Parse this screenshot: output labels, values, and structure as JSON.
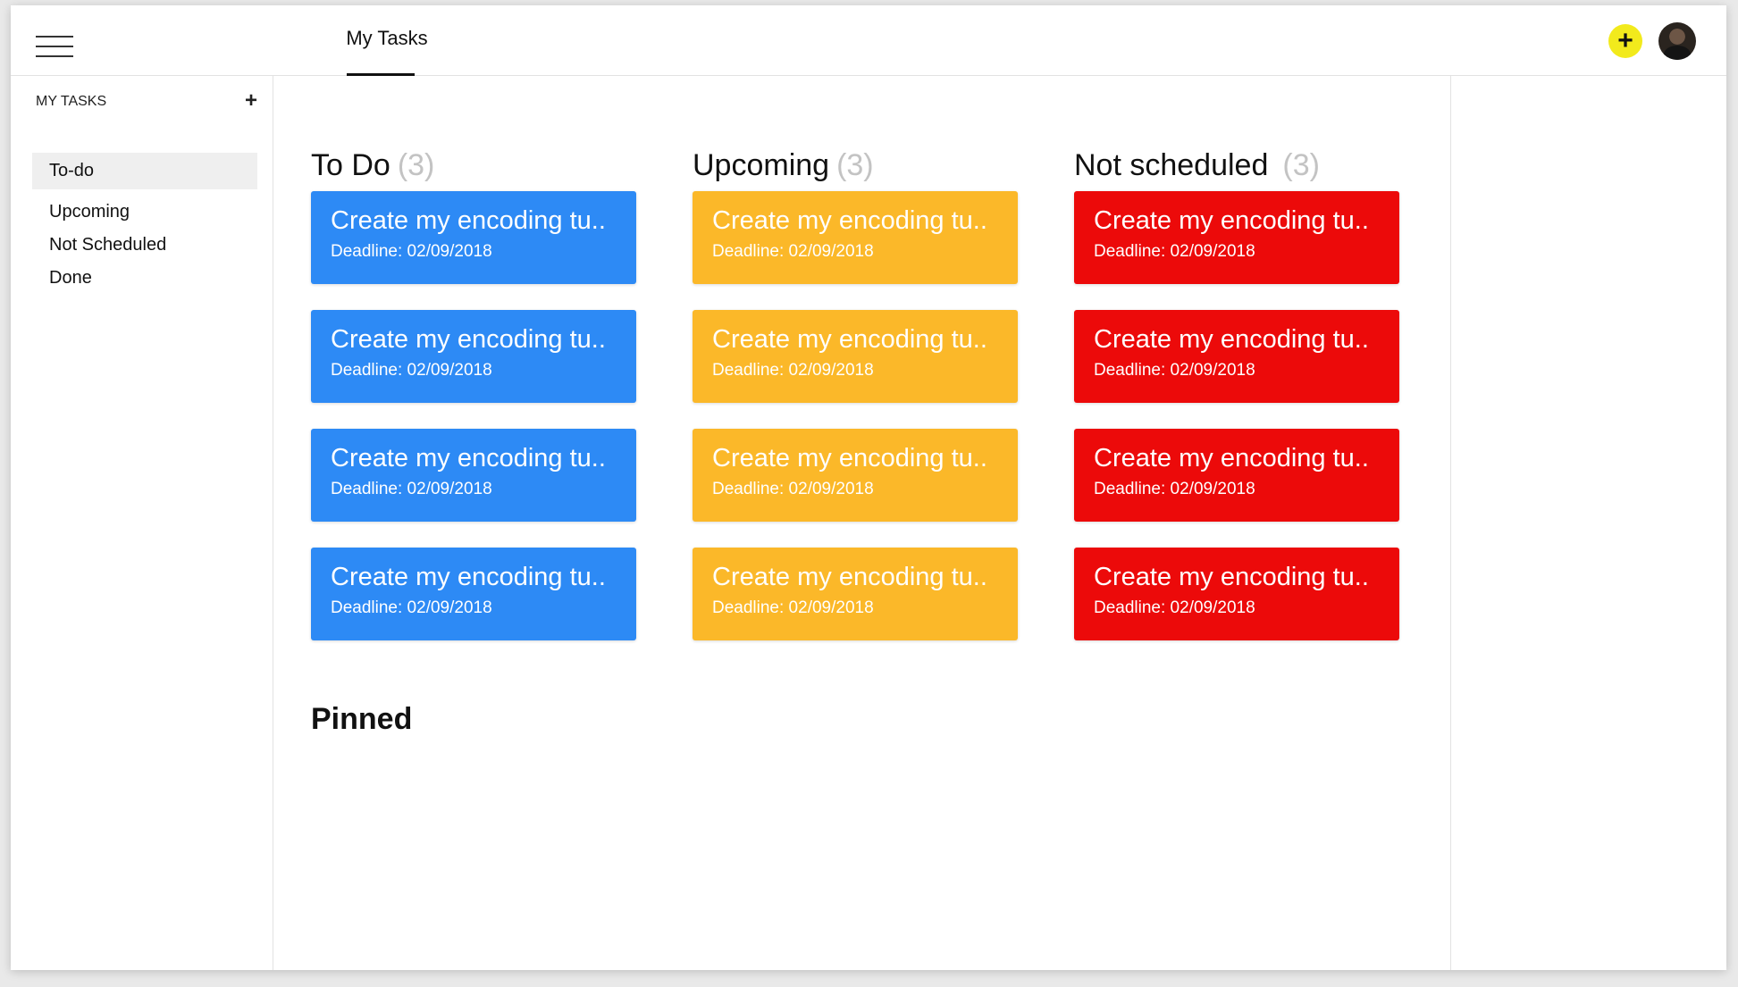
{
  "header": {
    "tab_label": "My Tasks"
  },
  "sidebar": {
    "header": "MY TASKS",
    "add_symbol": "+",
    "items": [
      {
        "label": "To-do"
      },
      {
        "label": "Upcoming"
      },
      {
        "label": "Not Scheduled"
      },
      {
        "label": "Done"
      }
    ]
  },
  "actions": {
    "add_symbol": "+"
  },
  "columns": [
    {
      "title": "To Do",
      "count": "(3)",
      "color": "#2d8af5",
      "cards": [
        {
          "title": "Create my encoding tu..",
          "deadline": "Deadline: 02/09/2018"
        },
        {
          "title": "Create my encoding tu..",
          "deadline": "Deadline: 02/09/2018"
        },
        {
          "title": "Create my encoding tu..",
          "deadline": "Deadline: 02/09/2018"
        },
        {
          "title": "Create my encoding tu..",
          "deadline": "Deadline: 02/09/2018"
        }
      ]
    },
    {
      "title": "Upcoming",
      "count": "(3)",
      "color": "#fbb829",
      "cards": [
        {
          "title": "Create my encoding tu..",
          "deadline": "Deadline: 02/09/2018"
        },
        {
          "title": "Create my encoding tu..",
          "deadline": "Deadline: 02/09/2018"
        },
        {
          "title": "Create my encoding tu..",
          "deadline": "Deadline: 02/09/2018"
        },
        {
          "title": "Create my encoding tu..",
          "deadline": "Deadline: 02/09/2018"
        }
      ]
    },
    {
      "title": "Not scheduled",
      "count": "(3)",
      "color": "#ec0a0a",
      "cards": [
        {
          "title": "Create my encoding tu..",
          "deadline": "Deadline: 02/09/2018"
        },
        {
          "title": "Create my encoding tu..",
          "deadline": "Deadline: 02/09/2018"
        },
        {
          "title": "Create my encoding tu..",
          "deadline": "Deadline: 02/09/2018"
        },
        {
          "title": "Create my encoding tu..",
          "deadline": "Deadline: 02/09/2018"
        }
      ]
    }
  ],
  "pinned": {
    "title": "Pinned"
  }
}
